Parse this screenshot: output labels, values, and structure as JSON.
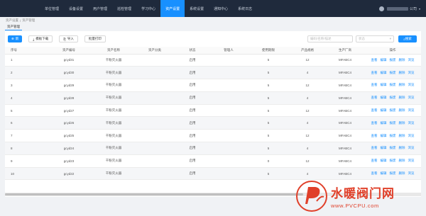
{
  "nav": {
    "items": [
      "单位管理",
      "设备设置",
      "用户管理",
      "巡检管理",
      "学习中心",
      "资产设置",
      "系统设置",
      "通知中心",
      "系统日志"
    ],
    "active_index": 5
  },
  "user": {
    "suffix": "公司"
  },
  "breadcrumb": {
    "items": [
      "资产设置",
      "资产管理"
    ]
  },
  "tab": {
    "label": "资产管理"
  },
  "toolbar": {
    "add_label": "新",
    "template_label": "模板下载",
    "import_label": "导入",
    "batch_print_label": "批量打印",
    "search_placeholder": "编码/名称/描述",
    "status_placeholder": "状态",
    "search_label": "搜索"
  },
  "table": {
    "headers": [
      "序号",
      "资产编号",
      "资产名称",
      "资产分类",
      "状态",
      "管理人",
      "使用期限",
      "产品规格",
      "生产厂商",
      "操作"
    ],
    "rows": [
      [
        "1",
        "gcyd31",
        "干粉灭火器",
        "",
        "启用",
        "",
        "5",
        "12",
        "MFABC4"
      ],
      [
        "2",
        "gcyd30",
        "干粉灭火器",
        "",
        "启用",
        "",
        "5",
        "4",
        "MFABC4"
      ],
      [
        "3",
        "gcyd29",
        "干粉灭火器",
        "",
        "启用",
        "",
        "5",
        "12",
        "MFABC4"
      ],
      [
        "4",
        "gcyd28",
        "干粉灭火器",
        "",
        "启用",
        "",
        "5",
        "4",
        "MFABC4"
      ],
      [
        "5",
        "gcyd27",
        "干粉灭火器",
        "",
        "启用",
        "",
        "5",
        "12",
        "MFABC4"
      ],
      [
        "6",
        "gcyd26",
        "干粉灭火器",
        "",
        "启用",
        "",
        "5",
        "4",
        "MFABC4"
      ],
      [
        "7",
        "gcyd25",
        "干粉灭火器",
        "",
        "启用",
        "",
        "5",
        "12",
        "MFABC4"
      ],
      [
        "8",
        "gcyd24",
        "干粉灭火器",
        "",
        "启用",
        "",
        "5",
        "4",
        "MFABC4"
      ],
      [
        "9",
        "gcyd23",
        "干粉灭火器",
        "",
        "启用",
        "",
        "0",
        "12",
        "MFABC4"
      ],
      [
        "10",
        "gcyd22",
        "干粉灭火器",
        "",
        "启用",
        "",
        "5",
        "4",
        "MFABC4"
      ]
    ],
    "ops": [
      "查看",
      "编辑",
      "报废",
      "删除",
      "浏览"
    ]
  },
  "watermark": {
    "cn": "水暖阀门网",
    "url": "www.PVCPU.com"
  },
  "colors": {
    "topbar": "#1f2a3c",
    "accent": "#1890ff",
    "watermark": "#e0402a"
  }
}
